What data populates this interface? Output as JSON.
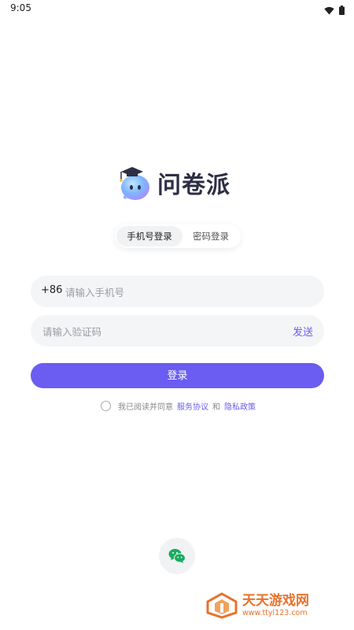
{
  "status": {
    "time": "9:05"
  },
  "app": {
    "name": "问卷派"
  },
  "tabs": [
    {
      "label": "手机号登录",
      "active": true
    },
    {
      "label": "密码登录",
      "active": false
    }
  ],
  "phone": {
    "prefix": "+86",
    "placeholder": "请输入手机号",
    "value": ""
  },
  "code": {
    "placeholder": "请输入验证码",
    "value": "",
    "send_label": "发送"
  },
  "login": {
    "label": "登录"
  },
  "agreement": {
    "text": "我已阅读并同意",
    "service": "服务协议",
    "and": "和",
    "privacy": "隐私政策",
    "checked": false
  },
  "social": {
    "icons": [
      "wechat-icon"
    ]
  },
  "watermark": {
    "title": "天天游戏网",
    "url": "www.ttyl123.com"
  },
  "colors": {
    "accent": "#6b5cf2",
    "wechat": "#1aad5e",
    "watermark": "#e8722b"
  }
}
